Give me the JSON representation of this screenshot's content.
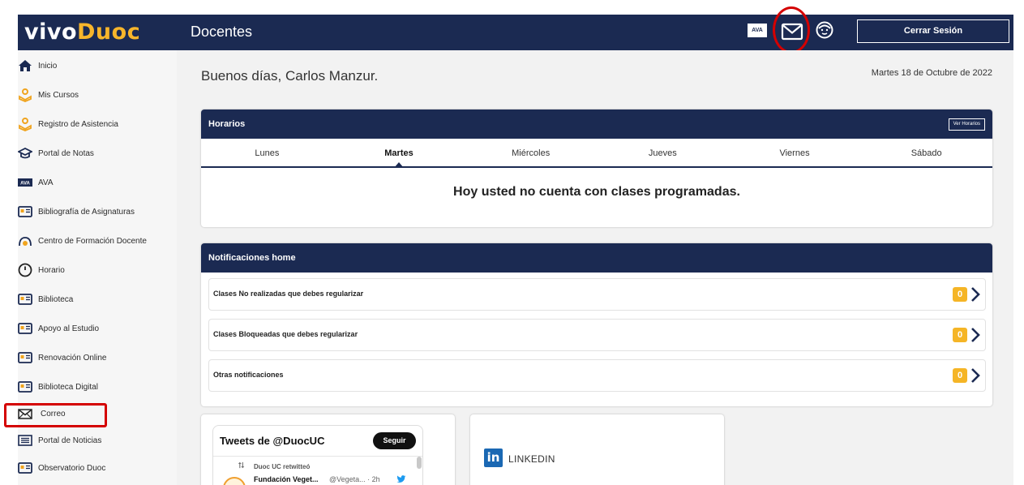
{
  "header": {
    "logo_part1": "vivo",
    "logo_part2": "Duoc",
    "section": "Docentes",
    "ava_badge": "AVA",
    "mail_icon": "mail-icon",
    "profile_icon": "face-icon",
    "logout_label": "Cerrar Sesión",
    "colors": {
      "navy": "#1b2a52",
      "brand_yellow": "#f7b52b",
      "highlight_red": "#d40000"
    }
  },
  "sidebar": {
    "items": [
      {
        "label": "Inicio",
        "icon": "home-icon"
      },
      {
        "label": "Mis Cursos",
        "icon": "courses-icon"
      },
      {
        "label": "Registro de Asistencia",
        "icon": "attendance-icon"
      },
      {
        "label": "Portal de Notas",
        "icon": "graduation-cap-icon"
      },
      {
        "label": "AVA",
        "icon": "ava-icon"
      },
      {
        "label": "Bibliografía de Asignaturas",
        "icon": "book-icon"
      },
      {
        "label": "Centro de Formación Docente",
        "icon": "training-center-icon"
      },
      {
        "label": "Horario",
        "icon": "clock-icon"
      },
      {
        "label": "Biblioteca",
        "icon": "library-icon"
      },
      {
        "label": "Apoyo al Estudio",
        "icon": "study-support-icon"
      },
      {
        "label": "Renovación Online",
        "icon": "renewal-icon"
      },
      {
        "label": "Biblioteca Digital",
        "icon": "digital-library-icon"
      },
      {
        "label": "Correo",
        "icon": "mail-icon"
      },
      {
        "label": "Portal de Noticias",
        "icon": "news-icon"
      },
      {
        "label": "Observatorio Duoc",
        "icon": "observatory-icon"
      }
    ]
  },
  "main": {
    "greeting": "Buenos días, Carlos Manzur.",
    "date": "Martes 18 de Octubre de 2022",
    "horarios": {
      "title": "Horarios",
      "button_label": "Ver Horarios",
      "days": [
        "Lunes",
        "Martes",
        "Miércoles",
        "Jueves",
        "Viernes",
        "Sábado"
      ],
      "selected_day": "Martes",
      "message": "Hoy usted no cuenta con clases programadas."
    },
    "notifications": {
      "title": "Notificaciones home",
      "rows": [
        {
          "label": "Clases No realizadas que debes regularizar",
          "count": "0"
        },
        {
          "label": "Clases Bloqueadas que debes regularizar",
          "count": "0"
        },
        {
          "label": "Otras notificaciones",
          "count": "0"
        }
      ]
    },
    "twitter": {
      "title": "Tweets de @DuocUC",
      "follow_label": "Seguir",
      "retweet_text": "Duoc UC retwitteó",
      "tweet_author": "Fundación Veget...",
      "tweet_handle": "@Vegeta... · 2h"
    },
    "linkedin": {
      "logo_text": "in",
      "label": "LINKEDIN"
    }
  }
}
